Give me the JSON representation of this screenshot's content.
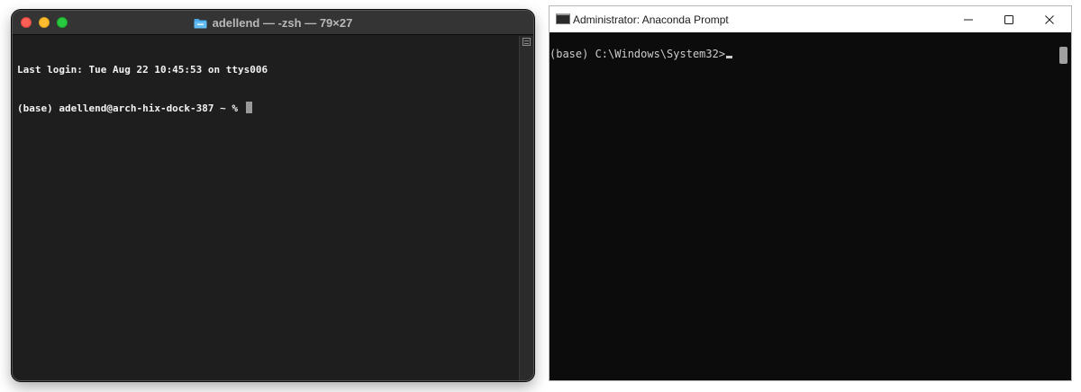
{
  "mac_terminal": {
    "title": "adellend — -zsh — 79×27",
    "lines": [
      "Last login: Tue Aug 22 10:45:53 on ttys006",
      "(base) adellend@arch-hix-dock-387 ~ % "
    ],
    "icons": {
      "folder": "folder-icon",
      "split": "split-pane-icon"
    },
    "colors": {
      "close": "#fe5f57",
      "minimize": "#febc2e",
      "maximize": "#28c840",
      "background": "#1e1e1e",
      "text": "#f2f2f2"
    }
  },
  "windows_prompt": {
    "title": "Administrator: Anaconda Prompt",
    "prompt_line": "(base) C:\\Windows\\System32>",
    "icons": {
      "app": "command-prompt-icon",
      "minimize": "minimize-icon",
      "maximize": "maximize-icon",
      "close": "close-icon"
    },
    "colors": {
      "background": "#0c0c0c",
      "text": "#cccccc"
    }
  }
}
